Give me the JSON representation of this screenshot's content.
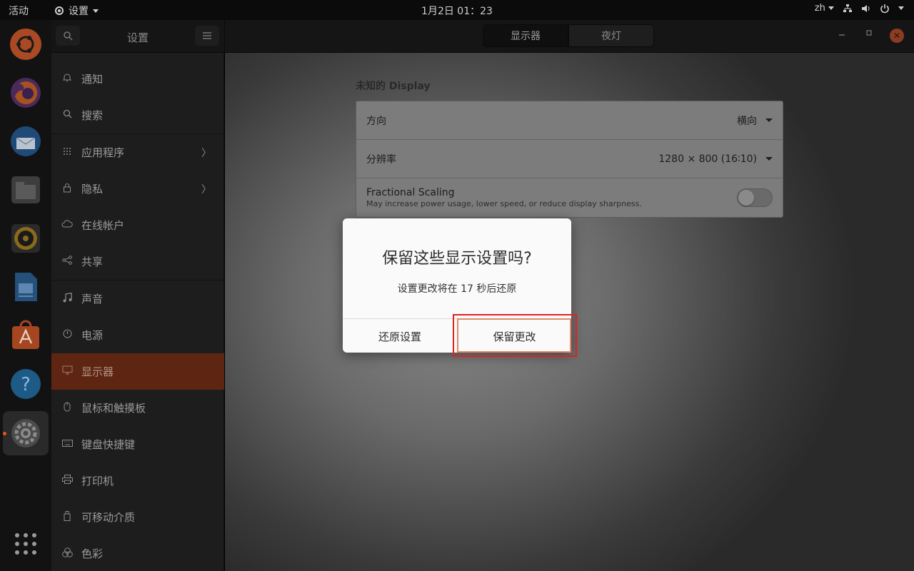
{
  "topbar": {
    "activities": "活动",
    "app_name": "设置",
    "clock": "1月2日  01：23",
    "lang": "zh"
  },
  "dock": {
    "items": [
      "ubuntu",
      "firefox",
      "thunderbird",
      "files",
      "rhythmbox",
      "libreoffice-writer",
      "app-center",
      "help",
      "settings"
    ],
    "show_apps": "show-applications"
  },
  "header": {
    "sidebar_title": "设置",
    "tabs": [
      {
        "label": "显示器",
        "active": true
      },
      {
        "label": "夜灯",
        "active": false
      }
    ]
  },
  "sidebar": {
    "items": [
      {
        "label": "通知",
        "icon": "bell-icon"
      },
      {
        "label": "搜索",
        "icon": "search-icon"
      },
      {
        "label": "应用程序",
        "icon": "apps-grid-icon",
        "chevron": true
      },
      {
        "label": "隐私",
        "icon": "lock-icon",
        "chevron": true
      },
      {
        "label": "在线帐户",
        "icon": "cloud-icon"
      },
      {
        "label": "共享",
        "icon": "share-icon"
      },
      {
        "label": "声音",
        "icon": "music-note-icon"
      },
      {
        "label": "电源",
        "icon": "power-icon"
      },
      {
        "label": "显示器",
        "icon": "monitor-icon",
        "selected": true
      },
      {
        "label": "鼠标和触摸板",
        "icon": "mouse-icon"
      },
      {
        "label": "键盘快捷键",
        "icon": "keyboard-icon"
      },
      {
        "label": "打印机",
        "icon": "printer-icon"
      },
      {
        "label": "可移动介质",
        "icon": "usb-drive-icon"
      },
      {
        "label": "色彩",
        "icon": "color-icon"
      }
    ]
  },
  "display": {
    "heading": "未知的 Display",
    "orientation_label": "方向",
    "orientation_value": "横向",
    "resolution_label": "分辨率",
    "resolution_value": "1280 × 800 (16∶10)",
    "scaling_label": "Fractional Scaling",
    "scaling_desc": "May increase power usage, lower speed, or reduce display sharpness.",
    "scaling_enabled": false
  },
  "dialog": {
    "title": "保留这些显示设置吗?",
    "message": "设置更改将在 17 秒后还原",
    "revert_label": "还原设置",
    "keep_label": "保留更改"
  },
  "colors": {
    "accent": "#e95420",
    "highlight": "#dd2222"
  }
}
